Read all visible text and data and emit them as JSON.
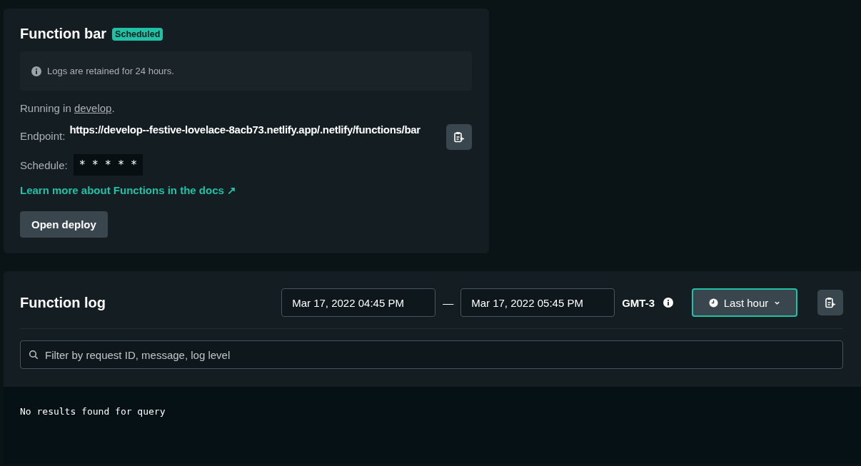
{
  "function_card": {
    "title": "Function bar",
    "badge": "Scheduled",
    "notice": "Logs are retained for 24 hours.",
    "running_prefix": "Running in ",
    "branch": "develop",
    "running_suffix": ".",
    "endpoint_label": "Endpoint:",
    "endpoint": "https://develop--festive-lovelace-8acb73.netlify.app/.netlify/functions/bar",
    "schedule_label": "Schedule:",
    "schedule": "* * * * *",
    "docs_link": "Learn more about Functions in the docs",
    "docs_link_arrow": "↗",
    "open_button": "Open deploy"
  },
  "function_log": {
    "title": "Function log",
    "start": "Mar 17, 2022 04:45 PM",
    "separator": "—",
    "end": "Mar 17, 2022 05:45 PM",
    "timezone": "GMT-3",
    "range_button": "Last hour",
    "filter": {
      "placeholder": "Filter by request ID, message, log level"
    },
    "empty_message": "No results found for query"
  }
}
